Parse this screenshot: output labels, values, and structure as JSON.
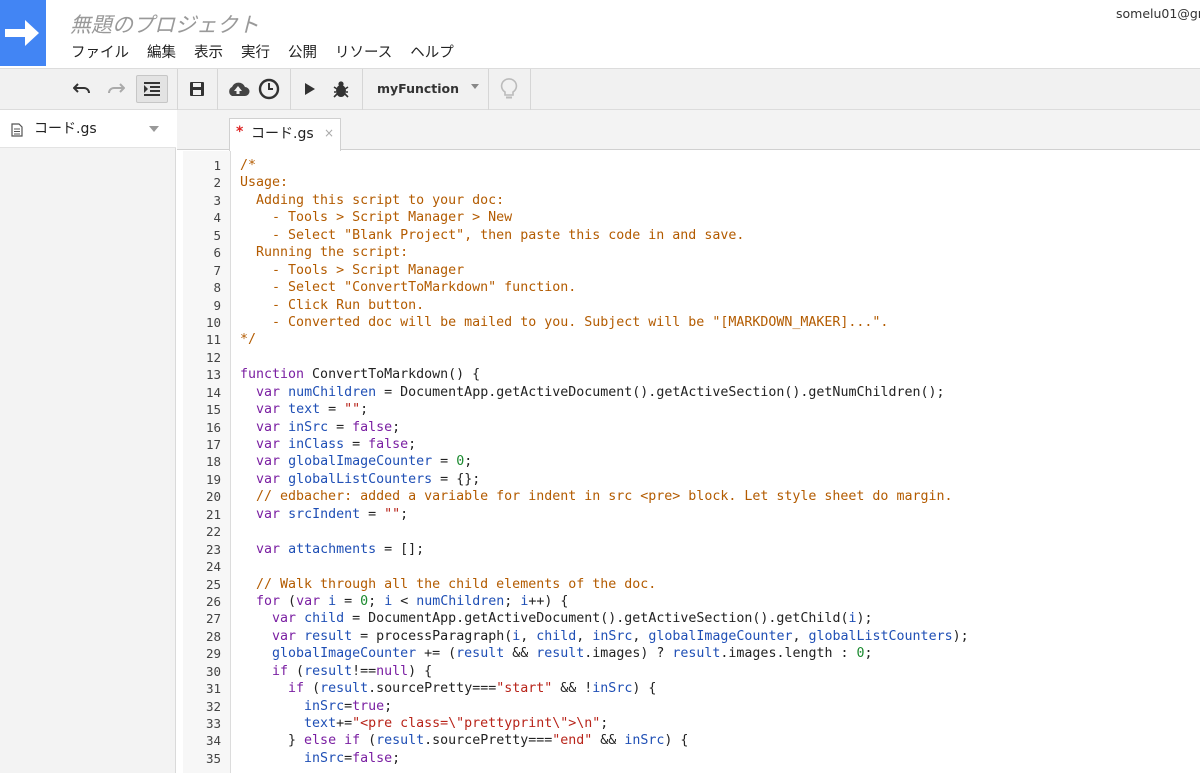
{
  "colors": {
    "logo": "#4285f4",
    "toolbar_bg": "#f1f1f1",
    "comment": "#b35b00",
    "keyword": "#7a1fa2",
    "variable": "#1f4fb5",
    "string": "#b8241a",
    "number": "#1b8a2f"
  },
  "header": {
    "project_title": "無題のプロジェクト",
    "account": "somelu01@gm",
    "logo_icon": "arrow-right-icon"
  },
  "menu": [
    "ファイル",
    "編集",
    "表示",
    "実行",
    "公開",
    "リソース",
    "ヘルプ"
  ],
  "toolbar": {
    "icons": [
      "undo-icon",
      "redo-icon",
      "indent-icon",
      "save-icon",
      "cloud-upload-icon",
      "clock-trigger-icon",
      "run-icon",
      "debug-bug-icon",
      "lightbulb-icon"
    ],
    "function_select": "myFunction"
  },
  "file_pane": {
    "files": [
      {
        "name": "コード.gs",
        "icon": "document-icon"
      }
    ]
  },
  "editor": {
    "tab": {
      "dirty_marker": "*",
      "label": "コード.gs",
      "close": "×"
    },
    "line_numbers": [
      "1",
      "2",
      "3",
      "4",
      "5",
      "6",
      "7",
      "8",
      "9",
      "10",
      "11",
      "12",
      "13",
      "14",
      "15",
      "16",
      "17",
      "18",
      "19",
      "20",
      "21",
      "22",
      "23",
      "24",
      "25",
      "26",
      "27",
      "28",
      "29",
      "30",
      "31",
      "32",
      "33",
      "34",
      "35"
    ],
    "lines": [
      [
        [
          "cm",
          "/*"
        ]
      ],
      [
        [
          "cm",
          "Usage:"
        ]
      ],
      [
        [
          "cm",
          "  Adding this script to your doc:"
        ]
      ],
      [
        [
          "cm",
          "    - Tools > Script Manager > New"
        ]
      ],
      [
        [
          "cm",
          "    - Select \"Blank Project\", then paste this code in and save."
        ]
      ],
      [
        [
          "cm",
          "  Running the script:"
        ]
      ],
      [
        [
          "cm",
          "    - Tools > Script Manager"
        ]
      ],
      [
        [
          "cm",
          "    - Select \"ConvertToMarkdown\" function."
        ]
      ],
      [
        [
          "cm",
          "    - Click Run button."
        ]
      ],
      [
        [
          "cm",
          "    - Converted doc will be mailed to you. Subject will be \"[MARKDOWN_MAKER]...\"."
        ]
      ],
      [
        [
          "cm",
          "*/"
        ]
      ],
      [],
      [
        [
          "kw",
          "function"
        ],
        [
          "pl",
          " ConvertToMarkdown() {"
        ]
      ],
      [
        [
          "pl",
          "  "
        ],
        [
          "kw",
          "var"
        ],
        [
          "pl",
          " "
        ],
        [
          "vr",
          "numChildren"
        ],
        [
          "pl",
          " = DocumentApp.getActiveDocument().getActiveSection().getNumChildren();"
        ]
      ],
      [
        [
          "pl",
          "  "
        ],
        [
          "kw",
          "var"
        ],
        [
          "pl",
          " "
        ],
        [
          "vr",
          "text"
        ],
        [
          "pl",
          " = "
        ],
        [
          "st",
          "\"\""
        ],
        [
          "pl",
          ";"
        ]
      ],
      [
        [
          "pl",
          "  "
        ],
        [
          "kw",
          "var"
        ],
        [
          "pl",
          " "
        ],
        [
          "vr",
          "inSrc"
        ],
        [
          "pl",
          " = "
        ],
        [
          "kw",
          "false"
        ],
        [
          "pl",
          ";"
        ]
      ],
      [
        [
          "pl",
          "  "
        ],
        [
          "kw",
          "var"
        ],
        [
          "pl",
          " "
        ],
        [
          "vr",
          "inClass"
        ],
        [
          "pl",
          " = "
        ],
        [
          "kw",
          "false"
        ],
        [
          "pl",
          ";"
        ]
      ],
      [
        [
          "pl",
          "  "
        ],
        [
          "kw",
          "var"
        ],
        [
          "pl",
          " "
        ],
        [
          "vr",
          "globalImageCounter"
        ],
        [
          "pl",
          " = "
        ],
        [
          "nm",
          "0"
        ],
        [
          "pl",
          ";"
        ]
      ],
      [
        [
          "pl",
          "  "
        ],
        [
          "kw",
          "var"
        ],
        [
          "pl",
          " "
        ],
        [
          "vr",
          "globalListCounters"
        ],
        [
          "pl",
          " = {};"
        ]
      ],
      [
        [
          "cm",
          "  // edbacher: added a variable for indent in src <pre> block. Let style sheet do margin."
        ]
      ],
      [
        [
          "pl",
          "  "
        ],
        [
          "kw",
          "var"
        ],
        [
          "pl",
          " "
        ],
        [
          "vr",
          "srcIndent"
        ],
        [
          "pl",
          " = "
        ],
        [
          "st",
          "\"\""
        ],
        [
          "pl",
          ";"
        ]
      ],
      [],
      [
        [
          "pl",
          "  "
        ],
        [
          "kw",
          "var"
        ],
        [
          "pl",
          " "
        ],
        [
          "vr",
          "attachments"
        ],
        [
          "pl",
          " = [];"
        ]
      ],
      [],
      [
        [
          "cm",
          "  // Walk through all the child elements of the doc."
        ]
      ],
      [
        [
          "pl",
          "  "
        ],
        [
          "kw",
          "for"
        ],
        [
          "pl",
          " ("
        ],
        [
          "kw",
          "var"
        ],
        [
          "pl",
          " "
        ],
        [
          "vr",
          "i"
        ],
        [
          "pl",
          " = "
        ],
        [
          "nm",
          "0"
        ],
        [
          "pl",
          "; "
        ],
        [
          "vr",
          "i"
        ],
        [
          "pl",
          " < "
        ],
        [
          "vr",
          "numChildren"
        ],
        [
          "pl",
          "; "
        ],
        [
          "vr",
          "i"
        ],
        [
          "pl",
          "++) {"
        ]
      ],
      [
        [
          "pl",
          "    "
        ],
        [
          "kw",
          "var"
        ],
        [
          "pl",
          " "
        ],
        [
          "vr",
          "child"
        ],
        [
          "pl",
          " = DocumentApp.getActiveDocument().getActiveSection().getChild("
        ],
        [
          "vr",
          "i"
        ],
        [
          "pl",
          ");"
        ]
      ],
      [
        [
          "pl",
          "    "
        ],
        [
          "kw",
          "var"
        ],
        [
          "pl",
          " "
        ],
        [
          "vr",
          "result"
        ],
        [
          "pl",
          " = processParagraph("
        ],
        [
          "vr",
          "i"
        ],
        [
          "pl",
          ", "
        ],
        [
          "vr",
          "child"
        ],
        [
          "pl",
          ", "
        ],
        [
          "vr",
          "inSrc"
        ],
        [
          "pl",
          ", "
        ],
        [
          "vr",
          "globalImageCounter"
        ],
        [
          "pl",
          ", "
        ],
        [
          "vr",
          "globalListCounters"
        ],
        [
          "pl",
          ");"
        ]
      ],
      [
        [
          "pl",
          "    "
        ],
        [
          "vr",
          "globalImageCounter"
        ],
        [
          "pl",
          " += ("
        ],
        [
          "vr",
          "result"
        ],
        [
          "pl",
          " && "
        ],
        [
          "vr",
          "result"
        ],
        [
          "pl",
          ".images) ? "
        ],
        [
          "vr",
          "result"
        ],
        [
          "pl",
          ".images.length : "
        ],
        [
          "nm",
          "0"
        ],
        [
          "pl",
          ";"
        ]
      ],
      [
        [
          "pl",
          "    "
        ],
        [
          "kw",
          "if"
        ],
        [
          "pl",
          " ("
        ],
        [
          "vr",
          "result"
        ],
        [
          "pl",
          "!=="
        ],
        [
          "kw",
          "null"
        ],
        [
          "pl",
          ") {"
        ]
      ],
      [
        [
          "pl",
          "      "
        ],
        [
          "kw",
          "if"
        ],
        [
          "pl",
          " ("
        ],
        [
          "vr",
          "result"
        ],
        [
          "pl",
          ".sourcePretty==="
        ],
        [
          "st",
          "\"start\""
        ],
        [
          "pl",
          " && !"
        ],
        [
          "vr",
          "inSrc"
        ],
        [
          "pl",
          ") {"
        ]
      ],
      [
        [
          "pl",
          "        "
        ],
        [
          "vr",
          "inSrc"
        ],
        [
          "pl",
          "="
        ],
        [
          "kw",
          "true"
        ],
        [
          "pl",
          ";"
        ]
      ],
      [
        [
          "pl",
          "        "
        ],
        [
          "vr",
          "text"
        ],
        [
          "pl",
          "+="
        ],
        [
          "st",
          "\"<pre class=\\\"prettyprint\\\">\\n\""
        ],
        [
          "pl",
          ";"
        ]
      ],
      [
        [
          "pl",
          "      } "
        ],
        [
          "kw",
          "else if"
        ],
        [
          "pl",
          " ("
        ],
        [
          "vr",
          "result"
        ],
        [
          "pl",
          ".sourcePretty==="
        ],
        [
          "st",
          "\"end\""
        ],
        [
          "pl",
          " && "
        ],
        [
          "vr",
          "inSrc"
        ],
        [
          "pl",
          ") {"
        ]
      ],
      [
        [
          "pl",
          "        "
        ],
        [
          "vr",
          "inSrc"
        ],
        [
          "pl",
          "="
        ],
        [
          "kw",
          "false"
        ],
        [
          "pl",
          ";"
        ]
      ]
    ]
  }
}
